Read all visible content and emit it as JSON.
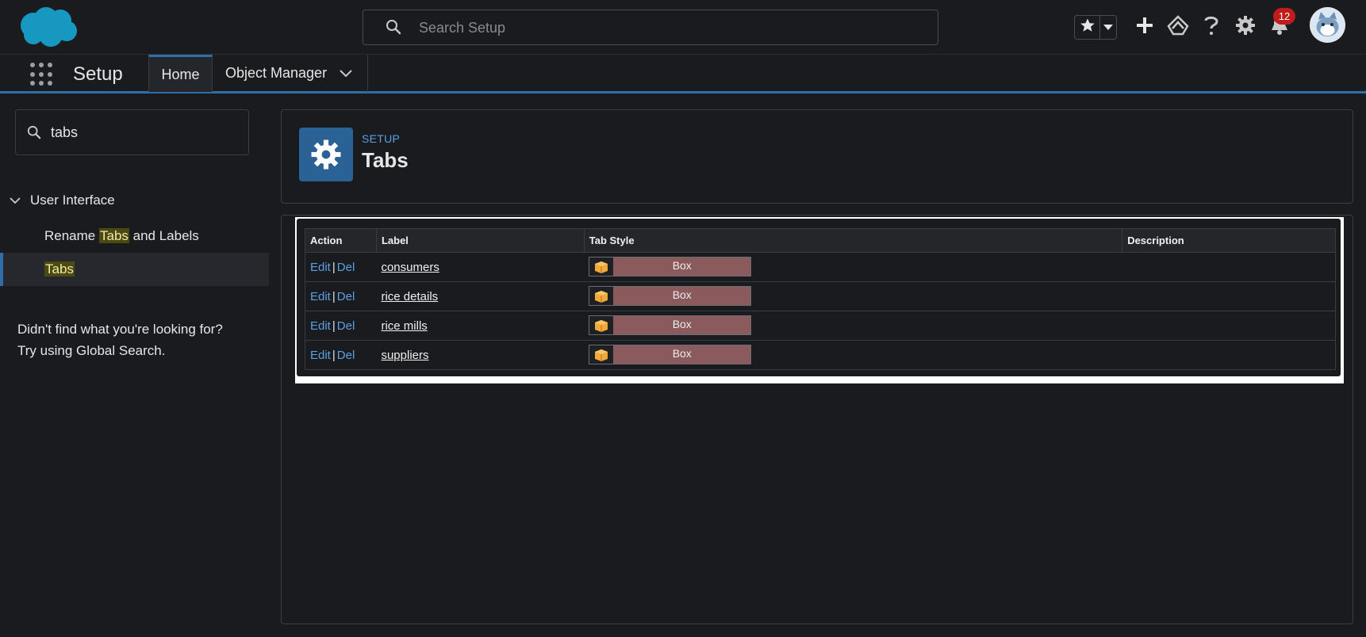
{
  "header": {
    "search_placeholder": "Search Setup",
    "notification_count": "12"
  },
  "nav": {
    "app_name": "Setup",
    "tabs": [
      {
        "label": "Home"
      },
      {
        "label": "Object Manager"
      }
    ]
  },
  "sidebar": {
    "quick_find_value": "tabs",
    "group_label": "User Interface",
    "items": [
      {
        "prefix": "Rename ",
        "match": "Tabs",
        "suffix": " and Labels"
      },
      {
        "prefix": "",
        "match": "Tabs",
        "suffix": ""
      }
    ],
    "not_found_line1": "Didn't find what you're looking for?",
    "not_found_line2": "Try using Global Search."
  },
  "page_header": {
    "eyebrow": "SETUP",
    "title": "Tabs"
  },
  "tabs_table": {
    "columns": [
      "Action",
      "Label",
      "Tab Style",
      "Description"
    ],
    "edit_label": "Edit",
    "separator": "|",
    "del_label": "Del",
    "rows": [
      {
        "label": "consumers",
        "style": "Box",
        "description": ""
      },
      {
        "label": "rice details",
        "style": "Box",
        "description": ""
      },
      {
        "label": "rice mills",
        "style": "Box",
        "description": ""
      },
      {
        "label": "suppliers",
        "style": "Box",
        "description": ""
      }
    ]
  },
  "colors": {
    "brand_blue": "#2b6296",
    "link_blue": "#5aa1e3",
    "badge_red": "#c01c1c",
    "tab_style_swatch": "#8a5a5c",
    "highlight": "#4a4a12"
  },
  "icons": [
    "salesforce-cloud-logo",
    "search-icon",
    "star-icon",
    "chevron-down-icon",
    "plus-icon",
    "trailhead-icon",
    "help-icon",
    "gear-icon",
    "bell-icon",
    "avatar",
    "waffle-icon",
    "box-icon"
  ]
}
